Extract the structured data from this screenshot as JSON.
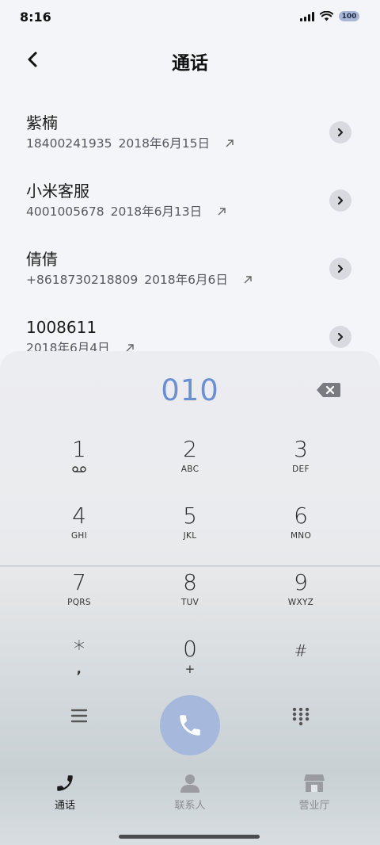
{
  "status": {
    "time": "8:16",
    "battery": "100"
  },
  "header": {
    "title": "通话"
  },
  "calls": [
    {
      "name": "紫楠",
      "number": "18400241935",
      "date": "2018年6月15日"
    },
    {
      "name": "小米客服",
      "number": "4001005678",
      "date": "2018年6月13日"
    },
    {
      "name": "倩倩",
      "number": "+8618730218809",
      "date": "2018年6月6日"
    },
    {
      "name": "1008611",
      "number": "",
      "date": "2018年6月4日"
    }
  ],
  "dialer": {
    "display": "010",
    "keys": [
      {
        "digit": "1",
        "sub": ""
      },
      {
        "digit": "2",
        "sub": "ABC"
      },
      {
        "digit": "3",
        "sub": "DEF"
      },
      {
        "digit": "4",
        "sub": "GHI"
      },
      {
        "digit": "5",
        "sub": "JKL"
      },
      {
        "digit": "6",
        "sub": "MNO"
      },
      {
        "digit": "7",
        "sub": "PQRS"
      },
      {
        "digit": "8",
        "sub": "TUV"
      },
      {
        "digit": "9",
        "sub": "WXYZ"
      },
      {
        "digit": "*",
        "sub": ","
      },
      {
        "digit": "0",
        "sub": "+"
      },
      {
        "digit": "#",
        "sub": ""
      }
    ]
  },
  "nav": {
    "calls": "通话",
    "contacts": "联系人",
    "hall": "营业厅"
  },
  "colors": {
    "accent": "#6b8fd0",
    "call_button": "#a6b9dc"
  }
}
